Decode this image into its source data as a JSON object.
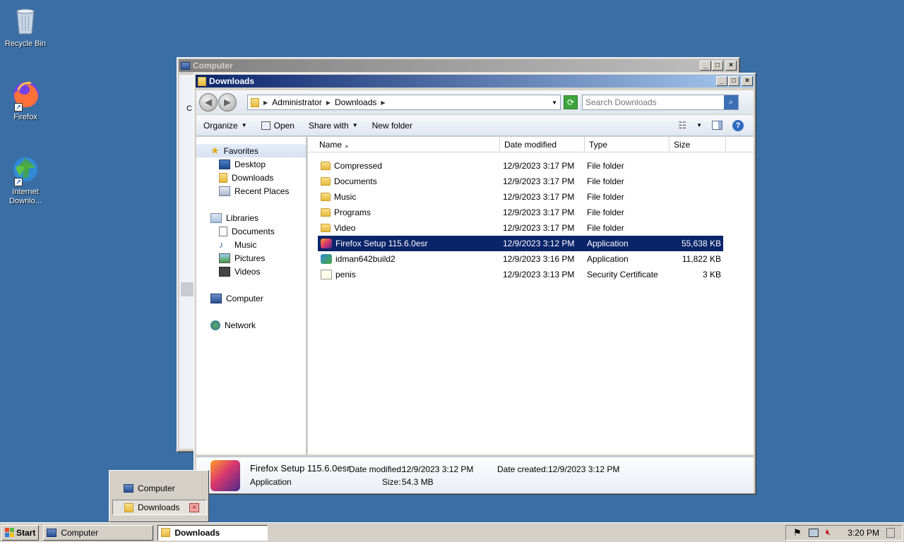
{
  "desktop": {
    "icons": [
      {
        "label": "Recycle Bin"
      },
      {
        "label": "Firefox"
      },
      {
        "label": "Internet Downlo..."
      }
    ]
  },
  "back_window": {
    "title": "Computer",
    "left_letter": "C"
  },
  "window": {
    "title": "Downloads",
    "address": {
      "crumbs": [
        "Administrator",
        "Downloads"
      ]
    },
    "search": {
      "placeholder": "Search Downloads"
    },
    "commands": {
      "organize": "Organize",
      "open": "Open",
      "share_with": "Share with",
      "new_folder": "New folder"
    },
    "nav": {
      "favorites": "Favorites",
      "desktop": "Desktop",
      "downloads": "Downloads",
      "recent_places": "Recent Places",
      "libraries": "Libraries",
      "documents": "Documents",
      "music": "Music",
      "pictures": "Pictures",
      "videos": "Videos",
      "computer": "Computer",
      "network": "Network"
    },
    "columns": {
      "name": "Name",
      "date": "Date modified",
      "type": "Type",
      "size": "Size"
    },
    "files": [
      {
        "name": "Compressed",
        "date": "12/9/2023 3:17 PM",
        "type": "File folder",
        "size": "",
        "icon": "folder-icon"
      },
      {
        "name": "Documents",
        "date": "12/9/2023 3:17 PM",
        "type": "File folder",
        "size": "",
        "icon": "folder-icon"
      },
      {
        "name": "Music",
        "date": "12/9/2023 3:17 PM",
        "type": "File folder",
        "size": "",
        "icon": "folder-icon"
      },
      {
        "name": "Programs",
        "date": "12/9/2023 3:17 PM",
        "type": "File folder",
        "size": "",
        "icon": "folder-icon"
      },
      {
        "name": "Video",
        "date": "12/9/2023 3:17 PM",
        "type": "File folder",
        "size": "",
        "icon": "folder-icon"
      },
      {
        "name": "Firefox Setup 115.6.0esr",
        "date": "12/9/2023 3:12 PM",
        "type": "Application",
        "size": "55,638 KB",
        "icon": "firefox-setup-icon",
        "selected": true
      },
      {
        "name": "idman642build2",
        "date": "12/9/2023 3:16 PM",
        "type": "Application",
        "size": "11,822 KB",
        "icon": "idm-setup-icon"
      },
      {
        "name": "penis",
        "date": "12/9/2023 3:13 PM",
        "type": "Security Certificate",
        "size": "3 KB",
        "icon": "certificate-icon"
      }
    ],
    "details": {
      "name": "Firefox Setup 115.6.0esr",
      "kind": "Application",
      "modified_label": "Date modified:",
      "modified": "12/9/2023 3:12 PM",
      "created_label": "Date created:",
      "created": "12/9/2023 3:12 PM",
      "size_label": "Size:",
      "size": "54.3 MB"
    }
  },
  "taskbar": {
    "start": "Start",
    "buttons": [
      "Computer",
      "Downloads"
    ],
    "clock": "3:20 PM",
    "flyout": [
      "Computer",
      "Downloads"
    ]
  },
  "colors": {
    "desktop": "#3a6ea5",
    "selection": "#0a246a",
    "title_active": "#0a246a"
  }
}
